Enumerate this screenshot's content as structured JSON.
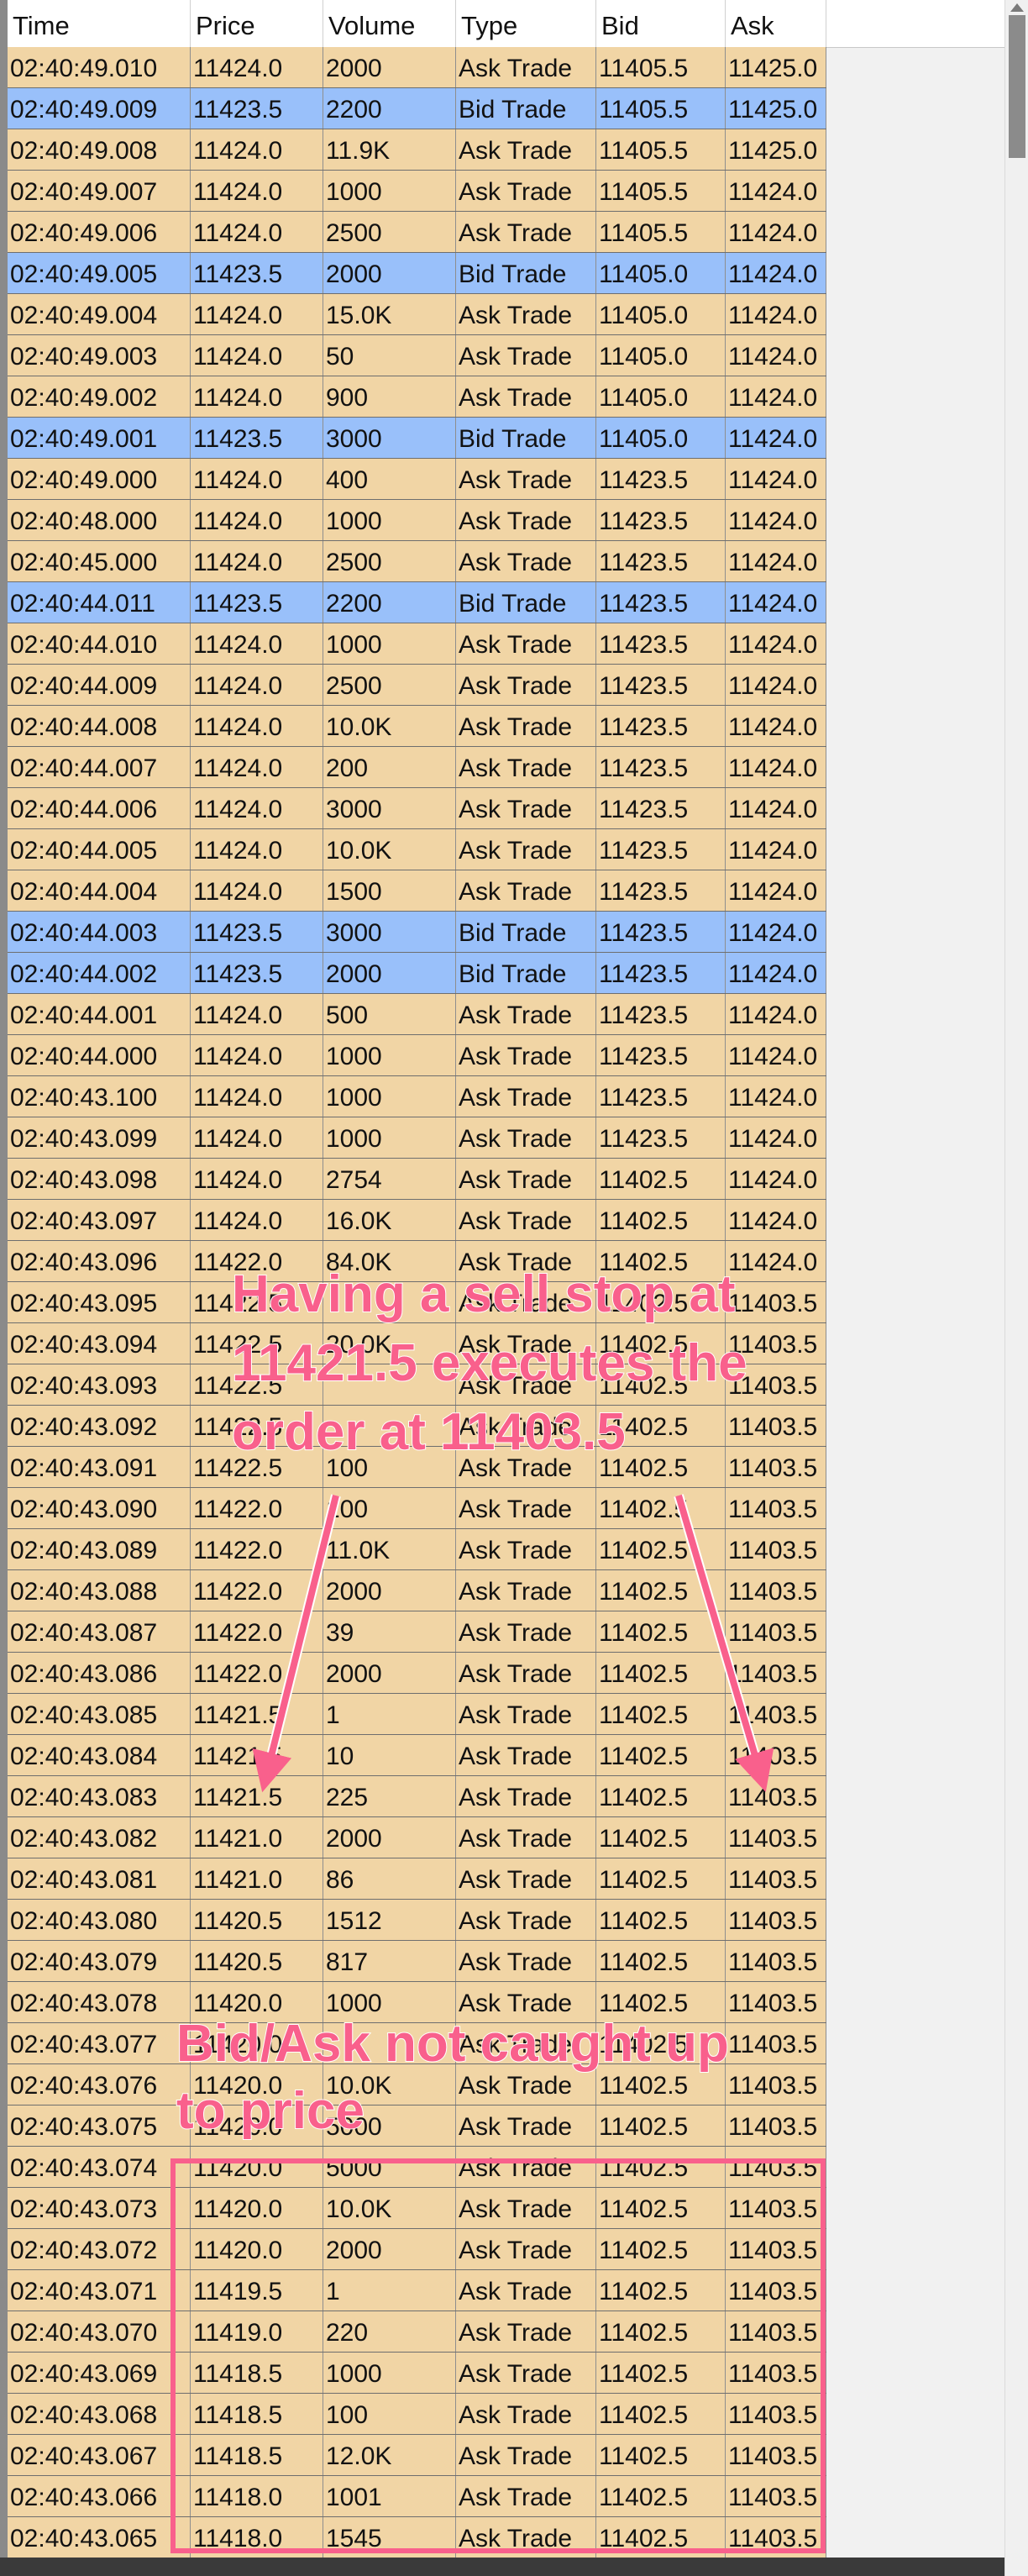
{
  "columns": [
    "Time",
    "Price",
    "Volume",
    "Type",
    "Bid",
    "Ask"
  ],
  "rows": [
    [
      "02:40:49.010",
      "11424.0",
      "2000",
      "Ask Trade",
      "11405.5",
      "11425.0"
    ],
    [
      "02:40:49.009",
      "11423.5",
      "2200",
      "Bid Trade",
      "11405.5",
      "11425.0"
    ],
    [
      "02:40:49.008",
      "11424.0",
      "11.9K",
      "Ask Trade",
      "11405.5",
      "11425.0"
    ],
    [
      "02:40:49.007",
      "11424.0",
      "1000",
      "Ask Trade",
      "11405.5",
      "11424.0"
    ],
    [
      "02:40:49.006",
      "11424.0",
      "2500",
      "Ask Trade",
      "11405.5",
      "11424.0"
    ],
    [
      "02:40:49.005",
      "11423.5",
      "2000",
      "Bid Trade",
      "11405.0",
      "11424.0"
    ],
    [
      "02:40:49.004",
      "11424.0",
      "15.0K",
      "Ask Trade",
      "11405.0",
      "11424.0"
    ],
    [
      "02:40:49.003",
      "11424.0",
      "50",
      "Ask Trade",
      "11405.0",
      "11424.0"
    ],
    [
      "02:40:49.002",
      "11424.0",
      "900",
      "Ask Trade",
      "11405.0",
      "11424.0"
    ],
    [
      "02:40:49.001",
      "11423.5",
      "3000",
      "Bid Trade",
      "11405.0",
      "11424.0"
    ],
    [
      "02:40:49.000",
      "11424.0",
      "400",
      "Ask Trade",
      "11423.5",
      "11424.0"
    ],
    [
      "02:40:48.000",
      "11424.0",
      "1000",
      "Ask Trade",
      "11423.5",
      "11424.0"
    ],
    [
      "02:40:45.000",
      "11424.0",
      "2500",
      "Ask Trade",
      "11423.5",
      "11424.0"
    ],
    [
      "02:40:44.011",
      "11423.5",
      "2200",
      "Bid Trade",
      "11423.5",
      "11424.0"
    ],
    [
      "02:40:44.010",
      "11424.0",
      "1000",
      "Ask Trade",
      "11423.5",
      "11424.0"
    ],
    [
      "02:40:44.009",
      "11424.0",
      "2500",
      "Ask Trade",
      "11423.5",
      "11424.0"
    ],
    [
      "02:40:44.008",
      "11424.0",
      "10.0K",
      "Ask Trade",
      "11423.5",
      "11424.0"
    ],
    [
      "02:40:44.007",
      "11424.0",
      "200",
      "Ask Trade",
      "11423.5",
      "11424.0"
    ],
    [
      "02:40:44.006",
      "11424.0",
      "3000",
      "Ask Trade",
      "11423.5",
      "11424.0"
    ],
    [
      "02:40:44.005",
      "11424.0",
      "10.0K",
      "Ask Trade",
      "11423.5",
      "11424.0"
    ],
    [
      "02:40:44.004",
      "11424.0",
      "1500",
      "Ask Trade",
      "11423.5",
      "11424.0"
    ],
    [
      "02:40:44.003",
      "11423.5",
      "3000",
      "Bid Trade",
      "11423.5",
      "11424.0"
    ],
    [
      "02:40:44.002",
      "11423.5",
      "2000",
      "Bid Trade",
      "11423.5",
      "11424.0"
    ],
    [
      "02:40:44.001",
      "11424.0",
      "500",
      "Ask Trade",
      "11423.5",
      "11424.0"
    ],
    [
      "02:40:44.000",
      "11424.0",
      "1000",
      "Ask Trade",
      "11423.5",
      "11424.0"
    ],
    [
      "02:40:43.100",
      "11424.0",
      "1000",
      "Ask Trade",
      "11423.5",
      "11424.0"
    ],
    [
      "02:40:43.099",
      "11424.0",
      "1000",
      "Ask Trade",
      "11423.5",
      "11424.0"
    ],
    [
      "02:40:43.098",
      "11424.0",
      "2754",
      "Ask Trade",
      "11402.5",
      "11424.0"
    ],
    [
      "02:40:43.097",
      "11424.0",
      "16.0K",
      "Ask Trade",
      "11402.5",
      "11424.0"
    ],
    [
      "02:40:43.096",
      "11422.0",
      "84.0K",
      "Ask Trade",
      "11402.5",
      "11424.0"
    ],
    [
      "02:40:43.095",
      "11422.5",
      "",
      "Ask Trade",
      "11402.5",
      "11403.5"
    ],
    [
      "02:40:43.094",
      "11422.5",
      "20.0K",
      "Ask Trade",
      "11402.5",
      "11403.5"
    ],
    [
      "02:40:43.093",
      "11422.5",
      "",
      "Ask Trade",
      "11402.5",
      "11403.5"
    ],
    [
      "02:40:43.092",
      "11422.5",
      "",
      "Ask Trade",
      "11402.5",
      "11403.5"
    ],
    [
      "02:40:43.091",
      "11422.5",
      "100",
      "Ask Trade",
      "11402.5",
      "11403.5"
    ],
    [
      "02:40:43.090",
      "11422.0",
      "100",
      "Ask Trade",
      "11402.5",
      "11403.5"
    ],
    [
      "02:40:43.089",
      "11422.0",
      "11.0K",
      "Ask Trade",
      "11402.5",
      "11403.5"
    ],
    [
      "02:40:43.088",
      "11422.0",
      "2000",
      "Ask Trade",
      "11402.5",
      "11403.5"
    ],
    [
      "02:40:43.087",
      "11422.0",
      "39",
      "Ask Trade",
      "11402.5",
      "11403.5"
    ],
    [
      "02:40:43.086",
      "11422.0",
      "2000",
      "Ask Trade",
      "11402.5",
      "11403.5"
    ],
    [
      "02:40:43.085",
      "11421.5",
      "1",
      "Ask Trade",
      "11402.5",
      "11403.5"
    ],
    [
      "02:40:43.084",
      "11421.5",
      "10",
      "Ask Trade",
      "11402.5",
      "11403.5"
    ],
    [
      "02:40:43.083",
      "11421.5",
      "225",
      "Ask Trade",
      "11402.5",
      "11403.5"
    ],
    [
      "02:40:43.082",
      "11421.0",
      "2000",
      "Ask Trade",
      "11402.5",
      "11403.5"
    ],
    [
      "02:40:43.081",
      "11421.0",
      "86",
      "Ask Trade",
      "11402.5",
      "11403.5"
    ],
    [
      "02:40:43.080",
      "11420.5",
      "1512",
      "Ask Trade",
      "11402.5",
      "11403.5"
    ],
    [
      "02:40:43.079",
      "11420.5",
      "817",
      "Ask Trade",
      "11402.5",
      "11403.5"
    ],
    [
      "02:40:43.078",
      "11420.0",
      "1000",
      "Ask Trade",
      "11402.5",
      "11403.5"
    ],
    [
      "02:40:43.077",
      "11420.0",
      "",
      "Ask Trade",
      "11402.5",
      "11403.5"
    ],
    [
      "02:40:43.076",
      "11420.0",
      "10.0K",
      "Ask Trade",
      "11402.5",
      "11403.5"
    ],
    [
      "02:40:43.075",
      "11420.0",
      "5000",
      "Ask Trade",
      "11402.5",
      "11403.5"
    ],
    [
      "02:40:43.074",
      "11420.0",
      "5000",
      "Ask Trade",
      "11402.5",
      "11403.5"
    ],
    [
      "02:40:43.073",
      "11420.0",
      "10.0K",
      "Ask Trade",
      "11402.5",
      "11403.5"
    ],
    [
      "02:40:43.072",
      "11420.0",
      "2000",
      "Ask Trade",
      "11402.5",
      "11403.5"
    ],
    [
      "02:40:43.071",
      "11419.5",
      "1",
      "Ask Trade",
      "11402.5",
      "11403.5"
    ],
    [
      "02:40:43.070",
      "11419.0",
      "220",
      "Ask Trade",
      "11402.5",
      "11403.5"
    ],
    [
      "02:40:43.069",
      "11418.5",
      "1000",
      "Ask Trade",
      "11402.5",
      "11403.5"
    ],
    [
      "02:40:43.068",
      "11418.5",
      "100",
      "Ask Trade",
      "11402.5",
      "11403.5"
    ],
    [
      "02:40:43.067",
      "11418.5",
      "12.0K",
      "Ask Trade",
      "11402.5",
      "11403.5"
    ],
    [
      "02:40:43.066",
      "11418.0",
      "1001",
      "Ask Trade",
      "11402.5",
      "11403.5"
    ],
    [
      "02:40:43.065",
      "11418.0",
      "1545",
      "Ask Trade",
      "11402.5",
      "11403.5"
    ]
  ],
  "annotations": {
    "sell_stop_line1": "Having a sell stop at",
    "sell_stop_line2": "11421.5 executes the",
    "sell_stop_line3": "order at 11403.5",
    "bid_ask_line1": "Bid/Ask not caught up",
    "bid_ask_line2": "to price"
  },
  "colors": {
    "ask_row": "#f1d5a5",
    "bid_row": "#99c0fa",
    "annotation": "#f9608c"
  }
}
